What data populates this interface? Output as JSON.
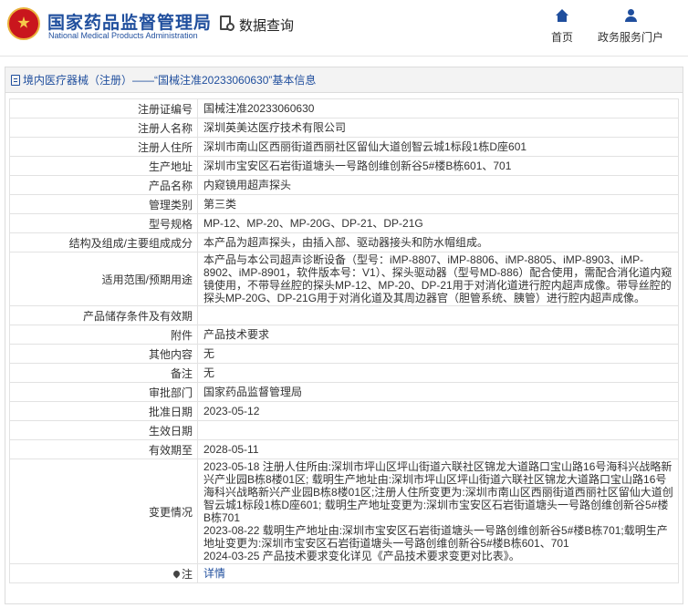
{
  "header": {
    "brand_cn": "国家药品监督管理局",
    "brand_en": "National Medical Products Administration",
    "query_label": "数据查询",
    "nav": {
      "home": "首页",
      "service": "政务服务门户"
    }
  },
  "panel": {
    "title": "境内医疗器械（注册）——“国械注准20233060630”基本信息"
  },
  "rows": [
    {
      "label": "注册证编号",
      "value": "国械注准20233060630"
    },
    {
      "label": "注册人名称",
      "value": "深圳英美达医疗技术有限公司"
    },
    {
      "label": "注册人住所",
      "value": "深圳市南山区西丽街道西丽社区留仙大道创智云城1标段1栋D座601"
    },
    {
      "label": "生产地址",
      "value": "深圳市宝安区石岩街道塘头一号路创维创新谷5#楼B栋601、701"
    },
    {
      "label": "产品名称",
      "value": "内窥镜用超声探头"
    },
    {
      "label": "管理类别",
      "value": "第三类"
    },
    {
      "label": "型号规格",
      "value": "MP-12、MP-20、MP-20G、DP-21、DP-21G"
    },
    {
      "label": "结构及组成/主要组成成分",
      "value": "本产品为超声探头，由插入部、驱动器接头和防水帽组成。"
    },
    {
      "label": "适用范围/预期用途",
      "value": "本产品与本公司超声诊断设备（型号：iMP-8807、iMP-8806、iMP-8805、iMP-8903、iMP-8902、iMP-8901，软件版本号：V1）、探头驱动器（型号MD-886）配合使用，需配合消化道内窥镜使用，不带导丝腔的探头MP-12、MP-20、DP-21用于对消化道进行腔内超声成像。带导丝腔的探头MP-20G、DP-21G用于对消化道及其周边器官（胆管系统、胰管）进行腔内超声成像。"
    },
    {
      "label": "产品储存条件及有效期",
      "value": ""
    },
    {
      "label": "附件",
      "value": "产品技术要求"
    },
    {
      "label": "其他内容",
      "value": "无"
    },
    {
      "label": "备注",
      "value": "无"
    },
    {
      "label": "审批部门",
      "value": "国家药品监督管理局"
    },
    {
      "label": "批准日期",
      "value": "2023-05-12"
    },
    {
      "label": "生效日期",
      "value": ""
    },
    {
      "label": "有效期至",
      "value": "2028-05-11"
    },
    {
      "label": "变更情况",
      "value": "2023-05-18 注册人住所由:深圳市坪山区坪山街道六联社区锦龙大道路口宝山路16号海科兴战略新兴产业园B栋8楼01区; 载明生产地址由:深圳市坪山区坪山街道六联社区锦龙大道路口宝山路16号海科兴战略新兴产业园B栋8楼01区;注册人住所变更为:深圳市南山区西丽街道西丽社区留仙大道创智云城1标段1栋D座601; 载明生产地址变更为:深圳市宝安区石岩街道塘头一号路创维创新谷5#楼B栋701\n2023-08-22 载明生产地址由:深圳市宝安区石岩街道塘头一号路创维创新谷5#楼B栋701;载明生产地址变更为:深圳市宝安区石岩街道塘头一号路创维创新谷5#楼B栋601、701\n2024-03-25 产品技术要求变化详见《产品技术要求变更对比表》。"
    }
  ],
  "note": {
    "label": "注",
    "link": "详情"
  }
}
